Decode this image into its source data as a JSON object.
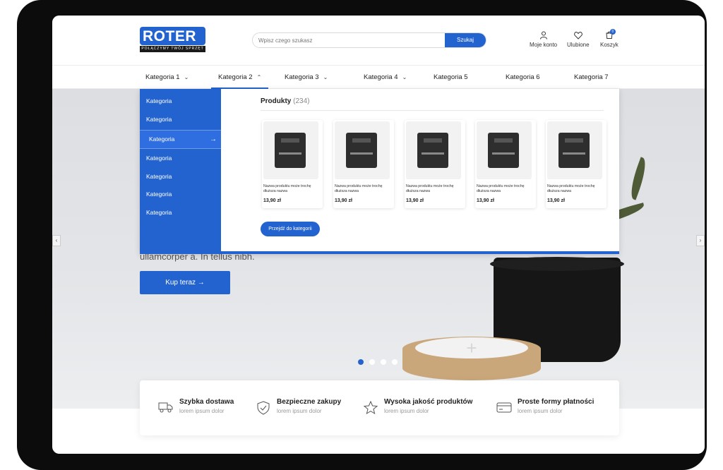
{
  "brand": {
    "logo_text": "ROTER",
    "tagline": "POŁĄCZYMY TWÓJ SPRZĘT"
  },
  "search": {
    "placeholder": "Wpisz czego szukasz",
    "button": "Szukaj"
  },
  "header_actions": {
    "account": "Moje konto",
    "favorites": "Ulubione",
    "cart": "Koszyk",
    "cart_count": "0"
  },
  "nav": [
    {
      "label": "Kategoria 1",
      "dropdown": true
    },
    {
      "label": "Kategoria 2",
      "dropdown": true,
      "active": true
    },
    {
      "label": "Kategoria 3",
      "dropdown": true
    },
    {
      "label": "Kategoria 4",
      "dropdown": true
    },
    {
      "label": "Kategoria 5"
    },
    {
      "label": "Kategoria 6"
    },
    {
      "label": "Kategoria 7"
    }
  ],
  "dropdown": {
    "categories": [
      "Kategoria",
      "Kategoria",
      "Kategoria",
      "Kategoria",
      "Kategoria",
      "Kategoria",
      "Kategoria"
    ],
    "selected_index": 2,
    "products_title": "Produkty",
    "products_count": "(234)",
    "products": [
      {
        "name": "Nazwa produktu może trochę dłuższa nazwa",
        "price": "13,90 zł"
      },
      {
        "name": "Nazwa produktu może trochę dłuższa nazwa",
        "price": "13,90 zł"
      },
      {
        "name": "Nazwa produktu może trochę dłuższa nazwa",
        "price": "13,90 zł"
      },
      {
        "name": "Nazwa produktu może trochę dłuższa nazwa",
        "price": "13,90 zł"
      },
      {
        "name": "Nazwa produktu może trochę dłuższa nazwa",
        "price": "13,90 zł"
      }
    ],
    "more_button": "Przejdź do kategorii"
  },
  "hero": {
    "text_fragment": "ullamcorper a. In tellus nibh.",
    "cta": "Kup teraz",
    "slides": 4,
    "active_slide": 0
  },
  "features": [
    {
      "title": "Szybka dostawa",
      "subtitle": "lorem ipsum dolor",
      "icon": "truck-icon"
    },
    {
      "title": "Bezpieczne zakupy",
      "subtitle": "lorem ipsum dolor",
      "icon": "shield-icon"
    },
    {
      "title": "Wysoka jakość produktów",
      "subtitle": "lorem ipsum dolor",
      "icon": "star-icon"
    },
    {
      "title": "Proste formy płatności",
      "subtitle": "lorem ipsum dolor",
      "icon": "card-icon"
    }
  ],
  "colors": {
    "accent": "#2363cf",
    "device_frame": "#0c0c0c"
  }
}
